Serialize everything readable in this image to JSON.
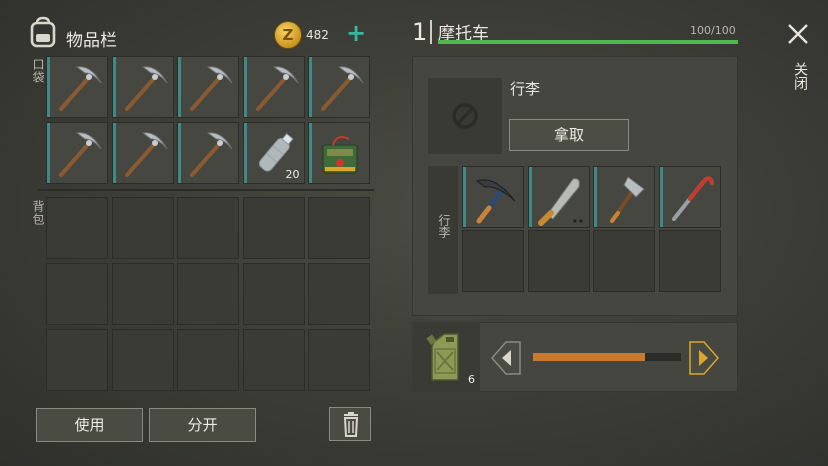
{
  "inventory": {
    "title": "物品栏",
    "coins": "482",
    "coin_letter": "Z",
    "add_label": "+",
    "pocket_label": "口袋",
    "backpack_label": "背包",
    "pocket_slots": [
      {
        "item": "pickaxe"
      },
      {
        "item": "pickaxe"
      },
      {
        "item": "pickaxe"
      },
      {
        "item": "pickaxe"
      },
      {
        "item": "pickaxe"
      },
      {
        "item": "pickaxe"
      },
      {
        "item": "pickaxe"
      },
      {
        "item": "pickaxe"
      },
      {
        "item": "water-bottle",
        "qty": "20"
      },
      {
        "item": "landmine"
      }
    ],
    "backpack_slots": 15
  },
  "buttons": {
    "use": "使用",
    "split": "分开",
    "delete_icon": "trash-icon"
  },
  "vehicle": {
    "level": "1",
    "name": "摩托车",
    "durability_text": "100/100",
    "durability_fraction": 1.0,
    "close_label": "关闭",
    "cargo_label": "行李",
    "cargo_empty_icon": "no-entry-icon",
    "take_label": "拿取",
    "trunk_label": "行李",
    "trunk_slots": [
      {
        "item": "pickaxe-blue"
      },
      {
        "item": "machete"
      },
      {
        "item": "hatchet"
      },
      {
        "item": "crowbar"
      },
      {},
      {},
      {},
      {}
    ]
  },
  "fuel": {
    "item": "jerrycan",
    "qty": "6",
    "level_fraction": 0.76
  },
  "colors": {
    "accent_teal": "#3f8a86",
    "durability_green": "#4bbb4f",
    "fuel_orange": "#c8792e",
    "arrow_gold": "#d8a72c"
  }
}
